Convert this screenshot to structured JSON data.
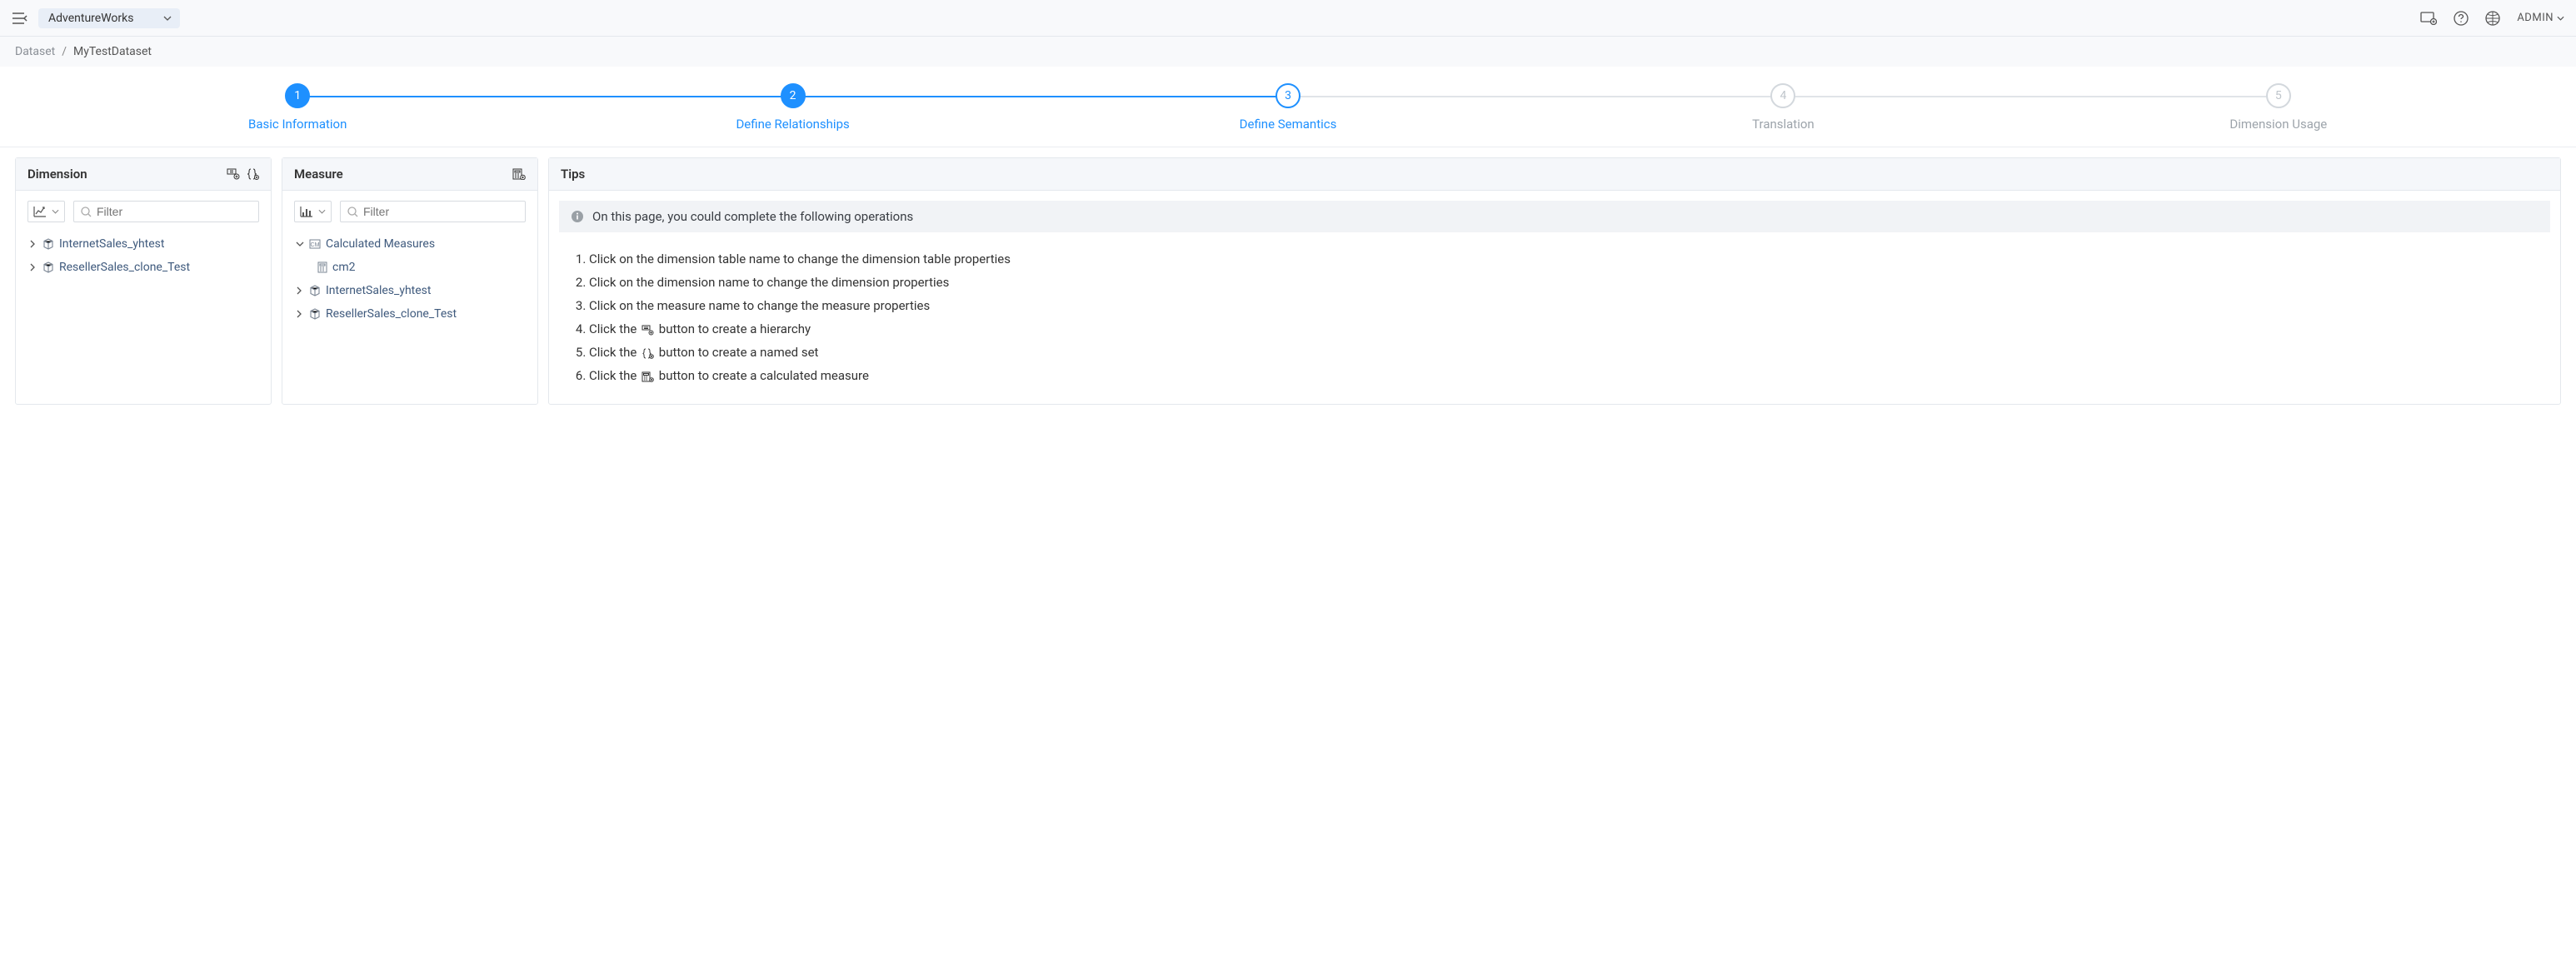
{
  "topbar": {
    "project": "AdventureWorks",
    "user_label": "ADMIN"
  },
  "breadcrumb": {
    "root": "Dataset",
    "current": "MyTestDataset"
  },
  "steps": [
    {
      "num": "1",
      "label": "Basic Information",
      "state": "done"
    },
    {
      "num": "2",
      "label": "Define Relationships",
      "state": "done"
    },
    {
      "num": "3",
      "label": "Define Semantics",
      "state": "active"
    },
    {
      "num": "4",
      "label": "Translation",
      "state": "pending"
    },
    {
      "num": "5",
      "label": "Dimension Usage",
      "state": "pending"
    }
  ],
  "dimension": {
    "title": "Dimension",
    "filter_placeholder": "Filter",
    "items": [
      "InternetSales_yhtest",
      "ResellerSales_clone_Test"
    ]
  },
  "measure": {
    "title": "Measure",
    "filter_placeholder": "Filter",
    "calc_group_label": "Calculated Measures",
    "calc_items": [
      "cm2"
    ],
    "items": [
      "InternetSales_yhtest",
      "ResellerSales_clone_Test"
    ]
  },
  "tips": {
    "title": "Tips",
    "banner": "On this page, you could complete the following operations",
    "list": [
      {
        "pre": "Click on the dimension table name to change the dimension table properties"
      },
      {
        "pre": "Click on the dimension name to change the dimension properties"
      },
      {
        "pre": "Click on the measure name to change the measure properties"
      },
      {
        "pre": "Click the ",
        "icon": "hierarchy",
        "post": " button to create a hierarchy"
      },
      {
        "pre": "Click the ",
        "icon": "namedset",
        "post": " button to create a named set"
      },
      {
        "pre": "Click the ",
        "icon": "calcmeasure",
        "post": " button to create a calculated measure"
      }
    ]
  }
}
